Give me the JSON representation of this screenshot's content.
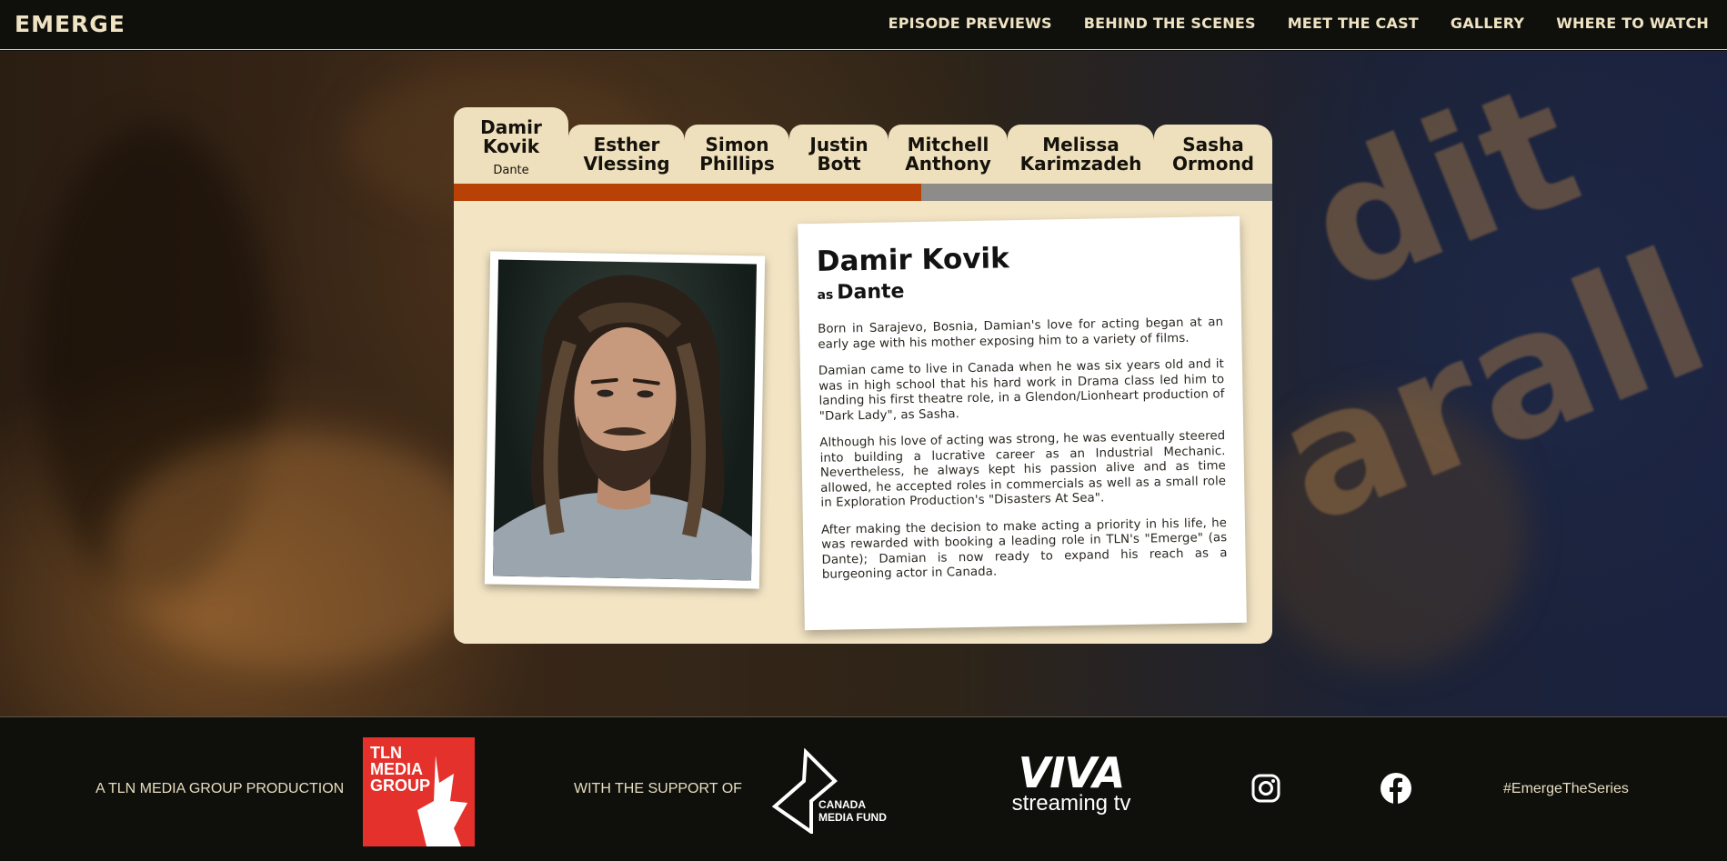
{
  "header": {
    "logo": "EMERGE",
    "nav": [
      "EPISODE PREVIEWS",
      "BEHIND THE SCENES",
      "MEET THE CAST",
      "GALLERY",
      "WHERE TO WATCH"
    ]
  },
  "cast": {
    "tabs": [
      {
        "first": "Damir",
        "last": "Kovik",
        "role": "Dante"
      },
      {
        "first": "Esther",
        "last": "Vlessing"
      },
      {
        "first": "Simon",
        "last": "Phillips"
      },
      {
        "first": "Justin",
        "last": "Bott"
      },
      {
        "first": "Mitchell",
        "last": "Anthony"
      },
      {
        "first": "Melissa",
        "last": "Karimzadeh"
      },
      {
        "first": "Sasha",
        "last": "Ormond"
      }
    ],
    "progress_fraction": 0.571,
    "colors": {
      "progress_fill": "#b84106",
      "progress_track": "#8e8c88",
      "panel": "#f3e5c4"
    },
    "selected": {
      "name": "Damir Kovik",
      "as_label": "as",
      "role": "Dante",
      "bio": [
        "Born in Sarajevo, Bosnia, Damian's love for acting began at an early age with his mother exposing him to a variety of films.",
        "Damian came to live in Canada when he was six years old and it was in high school that his hard work in Drama class led him to landing his first theatre role, in a Glendon/Lionheart production of \"Dark Lady\", as Sasha.",
        "Although his love of acting was strong, he was eventually steered into building a lucrative career as an Industrial Mechanic. Nevertheless, he always kept his passion alive and as time allowed, he accepted roles in commercials as well as a small role in Exploration Production's \"Disasters At Sea\".",
        "After making the decision to make acting a priority in his life, he was rewarded with booking a leading role in TLN's \"Emerge\" (as Dante); Damian is now ready to expand his reach as a burgeoning actor in Canada."
      ]
    }
  },
  "footer": {
    "production_text": "A TLN MEDIA GROUP PRODUCTION",
    "tln_logo_lines": [
      "TLN",
      "MEDIA",
      "GROUP"
    ],
    "support_text": "WITH THE SUPPORT OF",
    "cmf_lines": [
      "CANADA",
      "MEDIA FUND"
    ],
    "viva_big": "VIVA",
    "viva_small": "streaming tv",
    "hashtag": "#EmergeTheSeries",
    "icons": [
      "instagram-icon",
      "facebook-icon"
    ]
  }
}
